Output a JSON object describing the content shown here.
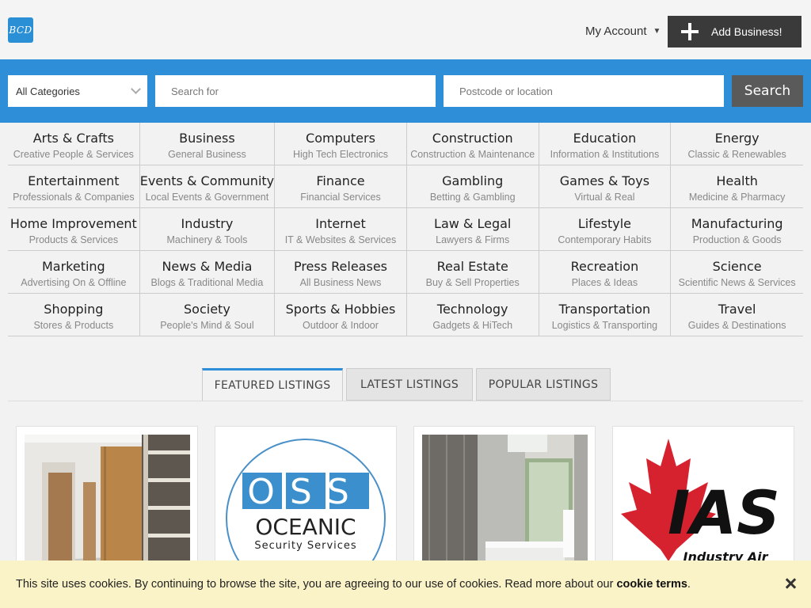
{
  "header": {
    "logo_text": "BCD",
    "account_label": "My Account",
    "add_business_label": "Add Business!"
  },
  "search": {
    "category_selected": "All Categories",
    "keyword_placeholder": "Search for",
    "location_placeholder": "Postcode or location",
    "button_label": "Search"
  },
  "categories": [
    {
      "title": "Arts & Crafts",
      "subtitle": "Creative People & Services"
    },
    {
      "title": "Business",
      "subtitle": "General Business"
    },
    {
      "title": "Computers",
      "subtitle": "High Tech Electronics"
    },
    {
      "title": "Construction",
      "subtitle": "Construction & Maintenance"
    },
    {
      "title": "Education",
      "subtitle": "Information & Institutions"
    },
    {
      "title": "Energy",
      "subtitle": "Classic & Renewables"
    },
    {
      "title": "Entertainment",
      "subtitle": "Professionals & Companies"
    },
    {
      "title": "Events & Community",
      "subtitle": "Local Events & Government"
    },
    {
      "title": "Finance",
      "subtitle": "Financial Services"
    },
    {
      "title": "Gambling",
      "subtitle": "Betting & Gambling"
    },
    {
      "title": "Games & Toys",
      "subtitle": "Virtual & Real"
    },
    {
      "title": "Health",
      "subtitle": "Medicine & Pharmacy"
    },
    {
      "title": "Home Improvement",
      "subtitle": "Products & Services"
    },
    {
      "title": "Industry",
      "subtitle": "Machinery & Tools"
    },
    {
      "title": "Internet",
      "subtitle": "IT & Websites & Services"
    },
    {
      "title": "Law & Legal",
      "subtitle": "Lawyers & Firms"
    },
    {
      "title": "Lifestyle",
      "subtitle": "Contemporary Habits"
    },
    {
      "title": "Manufacturing",
      "subtitle": "Production & Goods"
    },
    {
      "title": "Marketing",
      "subtitle": "Advertising On & Offline"
    },
    {
      "title": "News & Media",
      "subtitle": "Blogs & Traditional Media"
    },
    {
      "title": "Press Releases",
      "subtitle": "All Business News"
    },
    {
      "title": "Real Estate",
      "subtitle": "Buy & Sell Properties"
    },
    {
      "title": "Recreation",
      "subtitle": "Places & Ideas"
    },
    {
      "title": "Science",
      "subtitle": "Scientific News & Services"
    },
    {
      "title": "Shopping",
      "subtitle": "Stores & Products"
    },
    {
      "title": "Society",
      "subtitle": "People's Mind & Soul"
    },
    {
      "title": "Sports & Hobbies",
      "subtitle": "Outdoor & Indoor"
    },
    {
      "title": "Technology",
      "subtitle": "Gadgets & HiTech"
    },
    {
      "title": "Transportation",
      "subtitle": "Logistics & Transporting"
    },
    {
      "title": "Travel",
      "subtitle": "Guides & Destinations"
    }
  ],
  "tabs": [
    {
      "label": "FEATURED LISTINGS",
      "active": true
    },
    {
      "label": "LATEST LISTINGS",
      "active": false
    },
    {
      "label": "POPULAR LISTINGS",
      "active": false
    }
  ],
  "listings": {
    "oss_logo_letters": "OSS",
    "oss_logo_name": "OCEANIC",
    "oss_logo_tagline": "Security Services",
    "ias_logo_letters": "IAS",
    "ias_logo_tagline": "Industry Air"
  },
  "cookie": {
    "message": "This site uses cookies. By continuing to browse the site, you are agreeing to our use of cookies. Read more about our",
    "link_label": "cookie terms",
    "suffix": "."
  },
  "colors": {
    "brand_blue": "#2e8fd8",
    "dark_button": "#3a3a3a",
    "cookie_bg": "#faf3c8"
  }
}
